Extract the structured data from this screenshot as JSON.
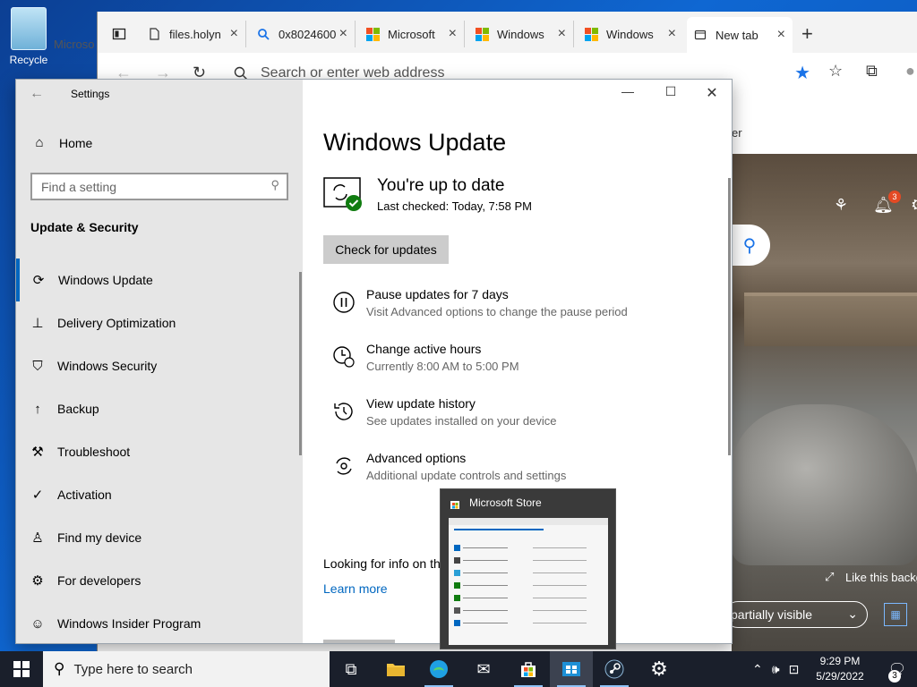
{
  "desktop": {
    "recycle_label": "Recycle"
  },
  "browser": {
    "tabs": [
      {
        "title": "",
        "icon": "tab-actions-icon"
      },
      {
        "title": "files.holyn",
        "icon": "document-icon"
      },
      {
        "title": "0x8024600",
        "icon": "search-icon"
      },
      {
        "title": "Microsoft",
        "icon": "microsoft-logo-icon"
      },
      {
        "title": "Windows",
        "icon": "microsoft-logo-icon"
      },
      {
        "title": "Windows",
        "icon": "microsoft-logo-icon"
      },
      {
        "title": "New tab",
        "icon": "newtab-icon"
      }
    ],
    "behind_tab_text": "Microso",
    "address_placeholder": "Search or enter web address",
    "partial_text": "er",
    "hero": {
      "like_text": "Like this backg",
      "dropdown_label": "partially visible",
      "notification_count": "3"
    }
  },
  "settings": {
    "title": "Settings",
    "home_label": "Home",
    "search_placeholder": "Find a setting",
    "section_heading": "Update & Security",
    "nav_items": [
      {
        "label": "Windows Update",
        "icon": "refresh-icon"
      },
      {
        "label": "Delivery Optimization",
        "icon": "delivery-icon"
      },
      {
        "label": "Windows Security",
        "icon": "shield-icon"
      },
      {
        "label": "Backup",
        "icon": "backup-arrow-icon"
      },
      {
        "label": "Troubleshoot",
        "icon": "wrench-icon"
      },
      {
        "label": "Activation",
        "icon": "check-circle-icon"
      },
      {
        "label": "Find my device",
        "icon": "person-pin-icon"
      },
      {
        "label": "For developers",
        "icon": "developer-icon"
      },
      {
        "label": "Windows Insider Program",
        "icon": "insider-cat-icon"
      }
    ],
    "page_title": "Windows Update",
    "status_title": "You're up to date",
    "status_sub": "Last checked: Today, 7:58 PM",
    "check_button": "Check for updates",
    "options": [
      {
        "title": "Pause updates for 7 days",
        "sub": "Visit Advanced options to change the pause period",
        "icon": "pause-icon"
      },
      {
        "title": "Change active hours",
        "sub": "Currently 8:00 AM to 5:00 PM",
        "icon": "clock-icon"
      },
      {
        "title": "View update history",
        "sub": "See updates installed on your device",
        "icon": "history-icon"
      },
      {
        "title": "Advanced options",
        "sub": "Additional update controls and settings",
        "icon": "advanced-gear-icon"
      }
    ],
    "looking_text": "Looking for info on the",
    "learn_more": "Learn more"
  },
  "store_thumbnail": {
    "title": "Microsoft Store"
  },
  "taskbar": {
    "search_placeholder": "Type here to search",
    "clock_time": "9:29 PM",
    "clock_date": "5/29/2022",
    "notification_count": "3"
  },
  "colors": {
    "accent": "#0067c0",
    "sidebar_bg": "#e6e6e6",
    "taskbar_bg": "#1a1f2b",
    "success_green": "#107c10"
  }
}
